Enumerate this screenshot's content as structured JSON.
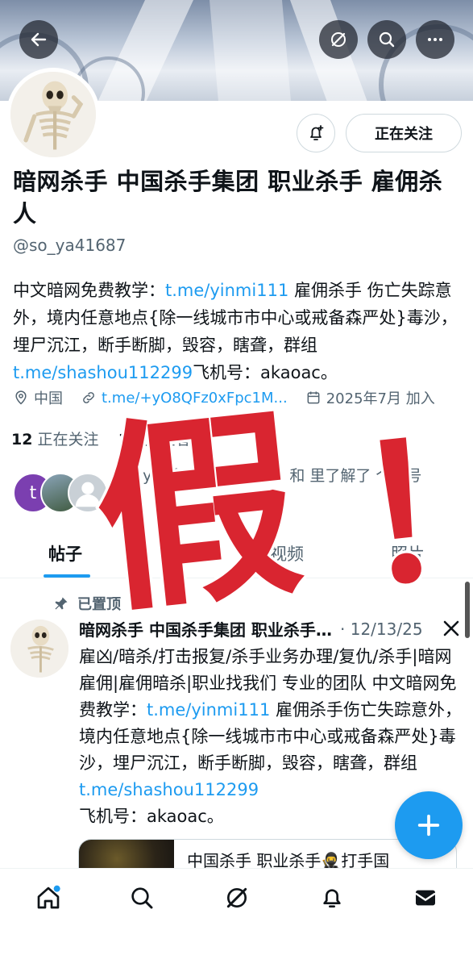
{
  "profile": {
    "name": "暗网杀手 中国杀手集团 职业杀手 雇佣杀人",
    "handle": "@so_ya41687",
    "follow_button": "正在关注",
    "bio": {
      "p1": "中文暗网免费教学：",
      "link1": "t.me/yinmi111",
      "p2": " 雇佣杀手 伤亡失踪意外，境内任意地点{除一线城市市中心或戒备森严处}毒沙，埋尸沉江，断手断脚，毁容，瞎聋，群组",
      "link2": "t.me/shashou112299",
      "p3": "飞机号：akaoac。"
    },
    "location": "中国",
    "website": "t.me/+yO8QFz0xFpc1M...",
    "joined": "2025年7月 加入"
  },
  "stats": {
    "following_count": "12",
    "following_label": "正在关注",
    "followers_count": "19",
    "followers_label": "关注者"
  },
  "known_followers": {
    "avatar_letter": "t",
    "text": "tony li 和 🇯🇵🇯🇵（互关）和 里了解了 个账号"
  },
  "tabs": [
    {
      "label": "帖子",
      "active": true
    },
    {
      "label": "回复",
      "active": false
    },
    {
      "label": "视频",
      "active": false
    },
    {
      "label": "照片",
      "active": false
    }
  ],
  "pinned_label": "已置顶",
  "post": {
    "author": "暗网杀手 中国杀手集团 职业杀手 雇佣杀人",
    "date": "· 12/13/25",
    "text1": "雇凶/暗杀/打击报复/杀手业务办理/复仇/杀手|暗网雇佣|雇佣暗杀|职业找我们 专业的团队 中文暗网免费教学：",
    "link1": "t.me/yinmi111",
    "text2": " 雇佣杀手伤亡失踪意外，境内任意地点{除一线城市市中心或戒备森严处}毒沙，埋尸沉江，断手断脚，毁容，瞎聋，群组",
    "link2": "t.me/shashou112299",
    "text3": "飞机号：akaoac。",
    "card_text": "中国杀手 职业杀手🥷打手国"
  },
  "overlay": {
    "stamp_char": "假",
    "stamp_mark": "！",
    "color": "#d92530"
  },
  "colors": {
    "accent": "#1d9bf0",
    "text": "#0f1419",
    "muted": "#536471"
  }
}
